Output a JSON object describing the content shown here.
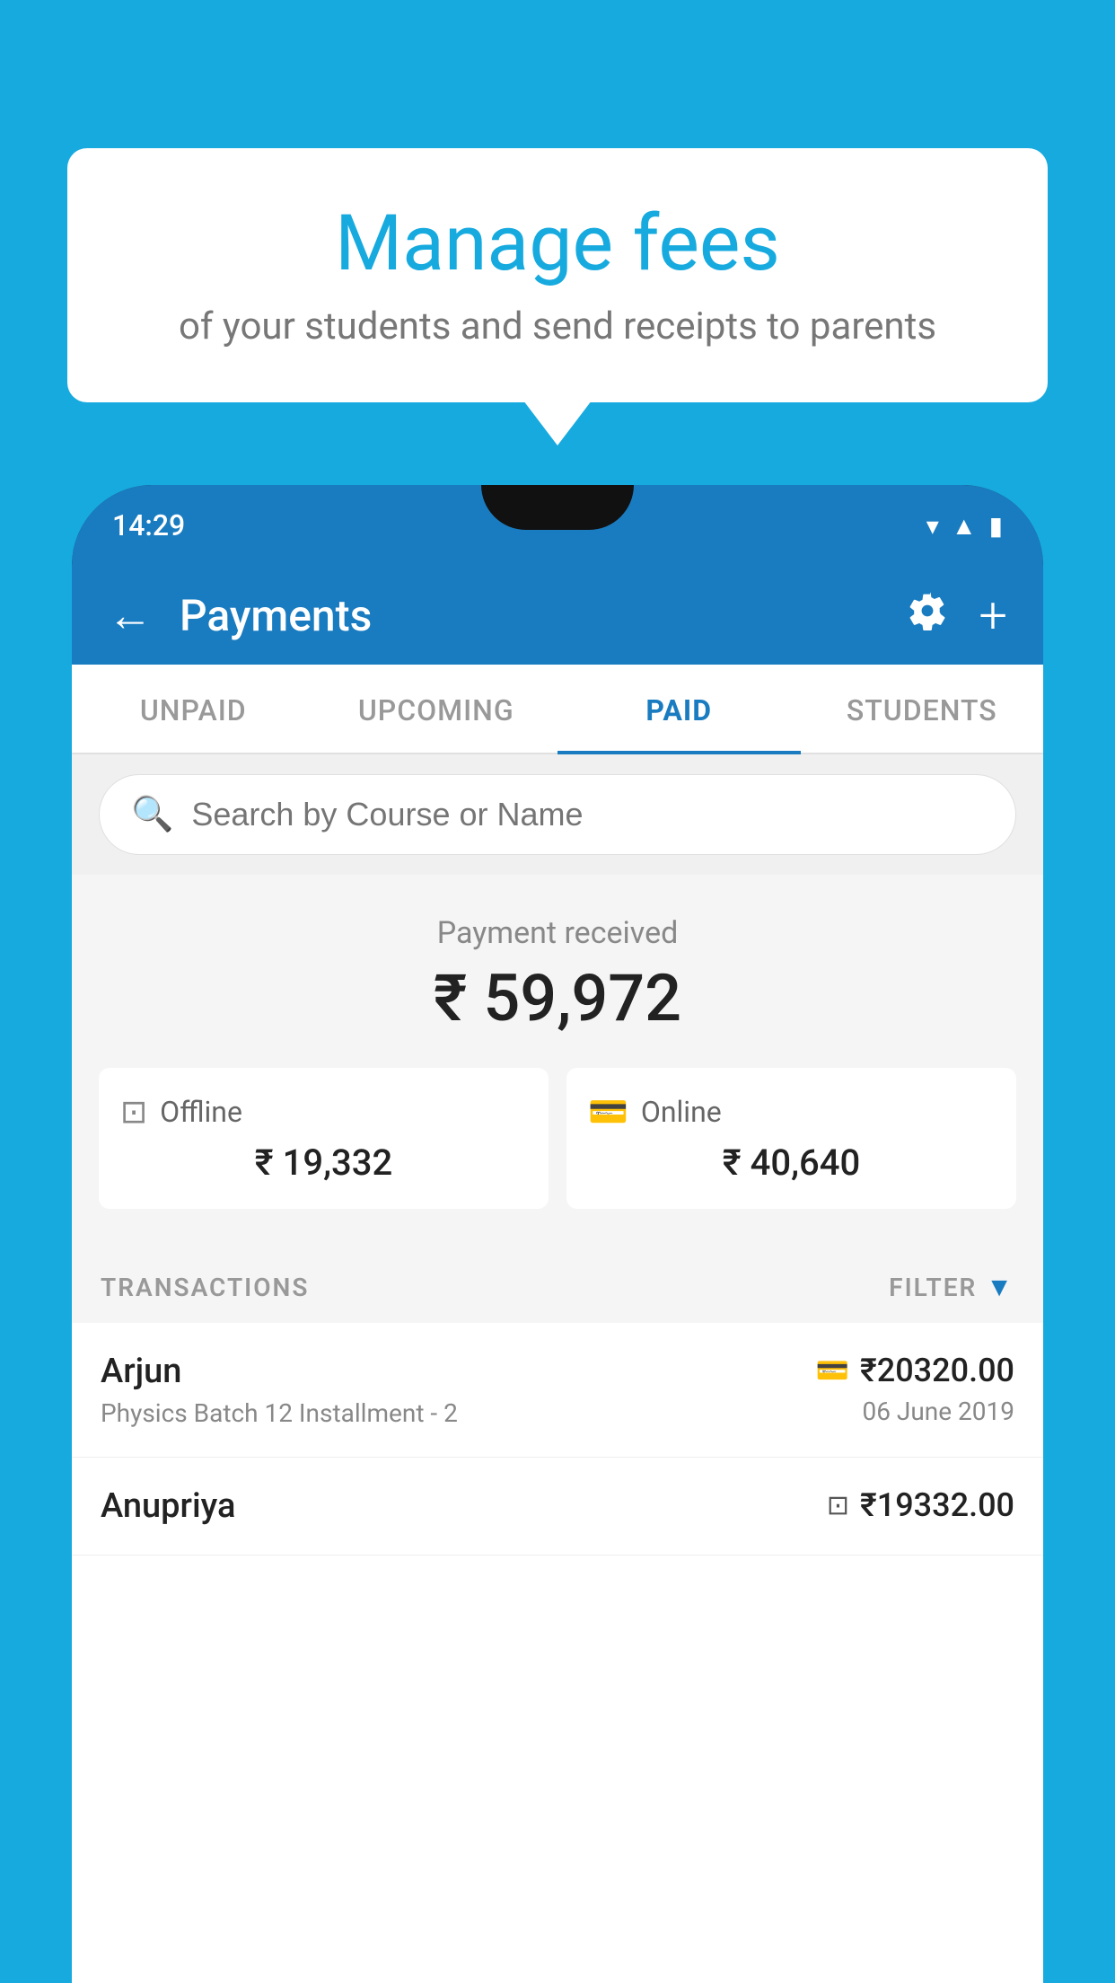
{
  "background_color": "#17AADF",
  "bubble": {
    "title": "Manage fees",
    "subtitle": "of your students and send receipts to parents"
  },
  "status_bar": {
    "time": "14:29",
    "icons": [
      "wifi",
      "signal",
      "battery"
    ]
  },
  "header": {
    "title": "Payments",
    "back_label": "←",
    "settings_label": "⚙",
    "add_label": "+"
  },
  "tabs": [
    {
      "label": "UNPAID",
      "active": false
    },
    {
      "label": "UPCOMING",
      "active": false
    },
    {
      "label": "PAID",
      "active": true
    },
    {
      "label": "STUDENTS",
      "active": false
    }
  ],
  "search": {
    "placeholder": "Search by Course or Name"
  },
  "payment_summary": {
    "label": "Payment received",
    "total": "₹ 59,972",
    "offline_label": "Offline",
    "offline_amount": "₹ 19,332",
    "online_label": "Online",
    "online_amount": "₹ 40,640"
  },
  "transactions": {
    "section_label": "TRANSACTIONS",
    "filter_label": "FILTER",
    "rows": [
      {
        "name": "Arjun",
        "detail": "Physics Batch 12 Installment - 2",
        "amount": "₹20320.00",
        "date": "06 June 2019",
        "payment_type": "online"
      },
      {
        "name": "Anupriya",
        "detail": "",
        "amount": "₹19332.00",
        "date": "",
        "payment_type": "offline"
      }
    ]
  }
}
